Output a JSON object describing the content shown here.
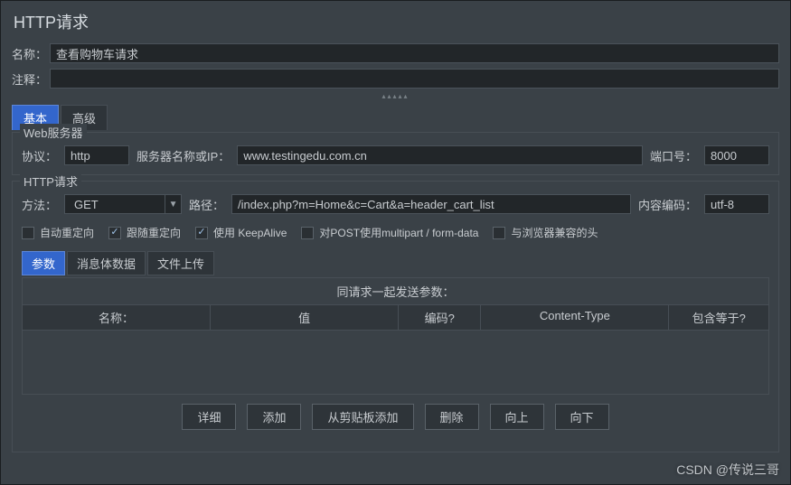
{
  "window": {
    "title": "HTTP请求"
  },
  "fields": {
    "name_label": "名称：",
    "name_value": "查看购物车请求",
    "comment_label": "注释：",
    "comment_value": ""
  },
  "tabs": {
    "basic": "基本",
    "advanced": "高级"
  },
  "web_server": {
    "legend": "Web服务器",
    "protocol_label": "协议：",
    "protocol_value": "http",
    "server_label": "服务器名称或IP：",
    "server_value": "www.testingedu.com.cn",
    "port_label": "端口号：",
    "port_value": "8000"
  },
  "http_request": {
    "legend": "HTTP请求",
    "method_label": "方法：",
    "method_value": "GET",
    "path_label": "路径：",
    "path_value": "/index.php?m=Home&c=Cart&a=header_cart_list",
    "encoding_label": "内容编码：",
    "encoding_value": "utf-8"
  },
  "checks": {
    "auto_redirect": "自动重定向",
    "follow_redirect": "跟随重定向",
    "keepalive": "使用 KeepAlive",
    "multipart": "对POST使用multipart / form-data",
    "browser_headers": "与浏览器兼容的头"
  },
  "sub_tabs": {
    "params": "参数",
    "body": "消息体数据",
    "files": "文件上传"
  },
  "params": {
    "title": "同请求一起发送参数：",
    "cols": {
      "name": "名称：",
      "value": "值",
      "encode": "编码?",
      "content_type": "Content-Type",
      "include_eq": "包含等于?"
    }
  },
  "buttons": {
    "detail": "详细",
    "add": "添加",
    "paste": "从剪贴板添加",
    "delete": "删除",
    "up": "向上",
    "down": "向下"
  },
  "watermark": "CSDN @传说三哥"
}
